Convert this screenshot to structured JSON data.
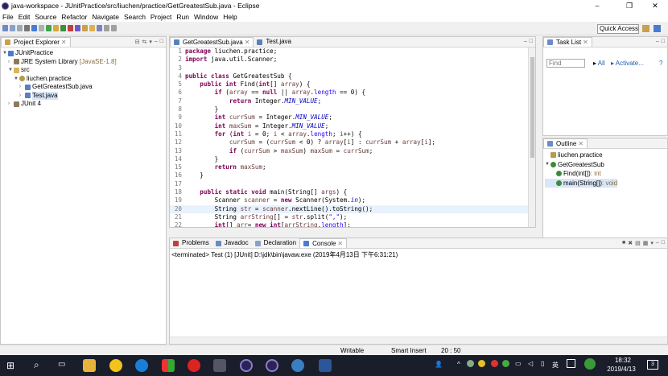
{
  "window": {
    "title": "java-workspace - JUnitPractice/src/liuchen/practice/GetGreatestSub.java - Eclipse",
    "minimize": "–",
    "maximize": "❐",
    "close": "✕"
  },
  "menu": [
    "File",
    "Edit",
    "Source",
    "Refactor",
    "Navigate",
    "Search",
    "Project",
    "Run",
    "Window",
    "Help"
  ],
  "quick_access": "Quick Access",
  "project_explorer": {
    "title": "Project Explorer",
    "items": [
      {
        "label": "JUnitPractice",
        "suffix": "",
        "level": 0,
        "icon": "project-icon"
      },
      {
        "label": "JRE System Library",
        "suffix": "[JavaSE-1.8]",
        "level": 1,
        "icon": "library-icon"
      },
      {
        "label": "src",
        "suffix": "",
        "level": 1,
        "icon": "folder-icon"
      },
      {
        "label": "liuchen.practice",
        "suffix": "",
        "level": 2,
        "icon": "package-icon"
      },
      {
        "label": "GetGreatestSub.java",
        "suffix": "",
        "level": 3,
        "icon": "java-file-icon"
      },
      {
        "label": "Test.java",
        "suffix": "",
        "level": 3,
        "icon": "java-file-icon"
      },
      {
        "label": "JUnit 4",
        "suffix": "",
        "level": 1,
        "icon": "library-icon"
      }
    ]
  },
  "editor": {
    "tabs": [
      {
        "label": "GetGreatestSub.java",
        "active": true
      },
      {
        "label": "Test.java",
        "active": false
      }
    ]
  },
  "task_list": {
    "title": "Task List",
    "find_placeholder": "Find",
    "all": "All",
    "activate": "Activate..."
  },
  "outline": {
    "title": "Outline",
    "items": [
      {
        "label": "liuchen.practice",
        "detail": "",
        "level": 0
      },
      {
        "label": "GetGreatestSub",
        "detail": "",
        "level": 0
      },
      {
        "label": "Find(int[])",
        "detail": " : int",
        "level": 1
      },
      {
        "label": "main(String[])",
        "detail": " : void",
        "level": 1
      }
    ]
  },
  "bottom": {
    "tabs": [
      "Problems",
      "Javadoc",
      "Declaration",
      "Console"
    ],
    "console_text": "<terminated> Test (1) [JUnit] D:\\jdk\\bin\\javaw.exe (2019年4月13日 下午6:31:21)"
  },
  "status": {
    "writable": "Writable",
    "insert": "Smart Insert",
    "position": "20 : 50"
  },
  "taskbar": {
    "time": "18:32",
    "date": "2019/4/13",
    "lang": "英",
    "notif_count": "3"
  }
}
